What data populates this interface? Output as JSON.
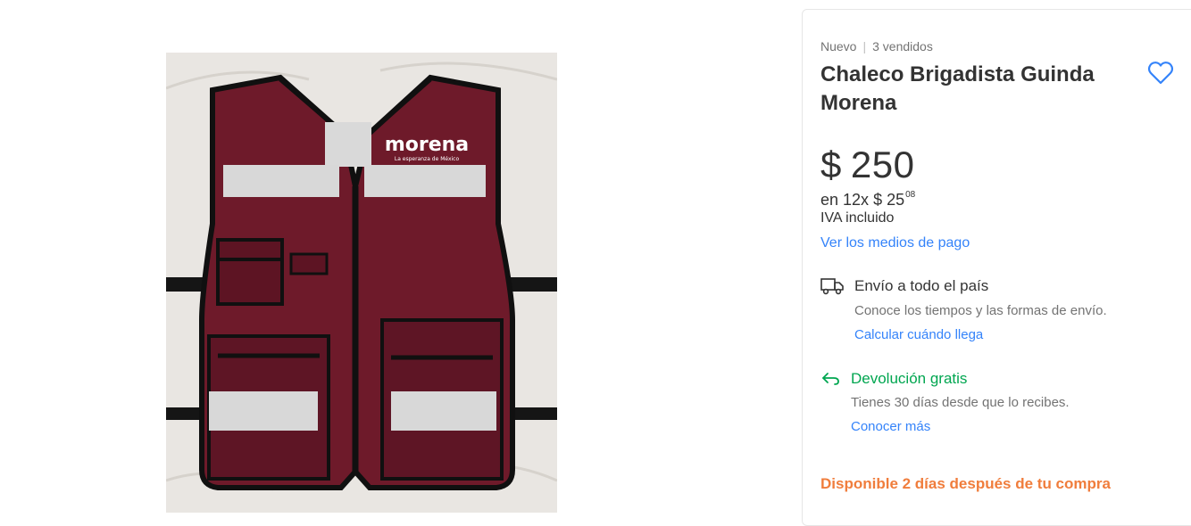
{
  "product": {
    "condition": "Nuevo",
    "sold": "3 vendidos",
    "title": "Chaleco Brigadista Guinda Morena",
    "image_alt": "morena",
    "image_tagline": "La esperanza de México"
  },
  "price": {
    "currency": "$",
    "amount": "250",
    "installments_prefix": "en 12x",
    "installment_amount": "$ 25",
    "installment_cents": "08",
    "tax_note": "IVA incluido",
    "payment_link": "Ver los medios de pago"
  },
  "shipping": {
    "title": "Envío a todo el país",
    "subtitle": "Conoce los tiempos y las formas de envío.",
    "link": "Calcular cuándo llega"
  },
  "returns": {
    "title": "Devolución gratis",
    "subtitle": "Tienes 30 días desde que lo recibes.",
    "link": "Conocer más"
  },
  "availability": "Disponible 2 días después de tu compra",
  "colors": {
    "link": "#3483fa",
    "success": "#00a650",
    "warning": "#f07d3c",
    "vest": "#6e1a2a"
  },
  "icons": [
    "heart-icon",
    "truck-icon",
    "return-arrow-icon"
  ]
}
